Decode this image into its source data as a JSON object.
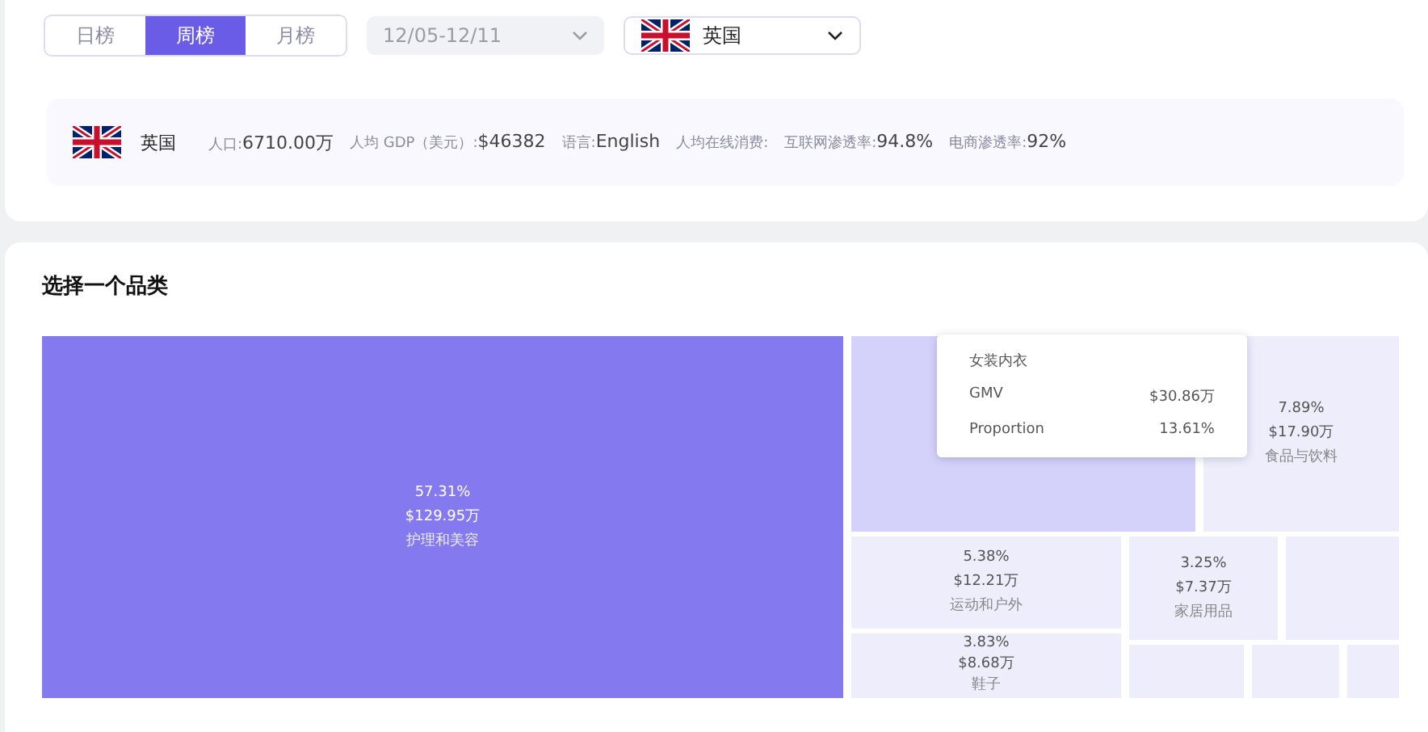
{
  "period_tabs": [
    {
      "label": "日榜",
      "selected": false
    },
    {
      "label": "周榜",
      "selected": true
    },
    {
      "label": "月榜",
      "selected": false
    }
  ],
  "date_select": {
    "value": "12/05-12/11",
    "disabled": true
  },
  "country_select": {
    "value": "英国"
  },
  "country_info": {
    "name": "英国",
    "stats": [
      {
        "label": "人口:",
        "value": "6710.00万"
      },
      {
        "label": "人均 GDP（美元）:",
        "value": "$46382"
      },
      {
        "label": "语言:",
        "value": "English"
      },
      {
        "label": "人均在线消费:"
      },
      {
        "label": "互联网渗透率:",
        "value": "94.8%"
      },
      {
        "label": "电商渗透率:",
        "value": "92%"
      }
    ]
  },
  "category_section": {
    "title": "选择一个品类",
    "tiles": [
      {
        "percent": "57.31%",
        "amount": "$129.95万",
        "name": "护理和美容",
        "color": "#8479ee"
      },
      {
        "color": "#d4d1fb"
      },
      {
        "percent": "7.89%",
        "amount": "$17.90万",
        "name": "食品与饮料",
        "color": "#eeedfc"
      },
      {
        "percent": "5.38%",
        "amount": "$12.21万",
        "name": "运动和户外",
        "color": "#eeedfc"
      },
      {
        "percent": "3.25%",
        "amount": "$7.37万",
        "name": "家居用品",
        "color": "#eeedfc"
      },
      {
        "color": "#eeedfc"
      },
      {
        "percent": "3.83%",
        "amount": "$8.68万",
        "name": "鞋子",
        "color": "#eeedfc"
      },
      {
        "color": "#eeedfc"
      },
      {
        "color": "#eeedfc"
      },
      {
        "color": "#eeedfc"
      }
    ],
    "tooltip": {
      "title": "女装内衣",
      "rows": [
        {
          "label": "GMV",
          "value": "$30.86万"
        },
        {
          "label": "Proportion",
          "value": "13.61%"
        }
      ]
    }
  }
}
